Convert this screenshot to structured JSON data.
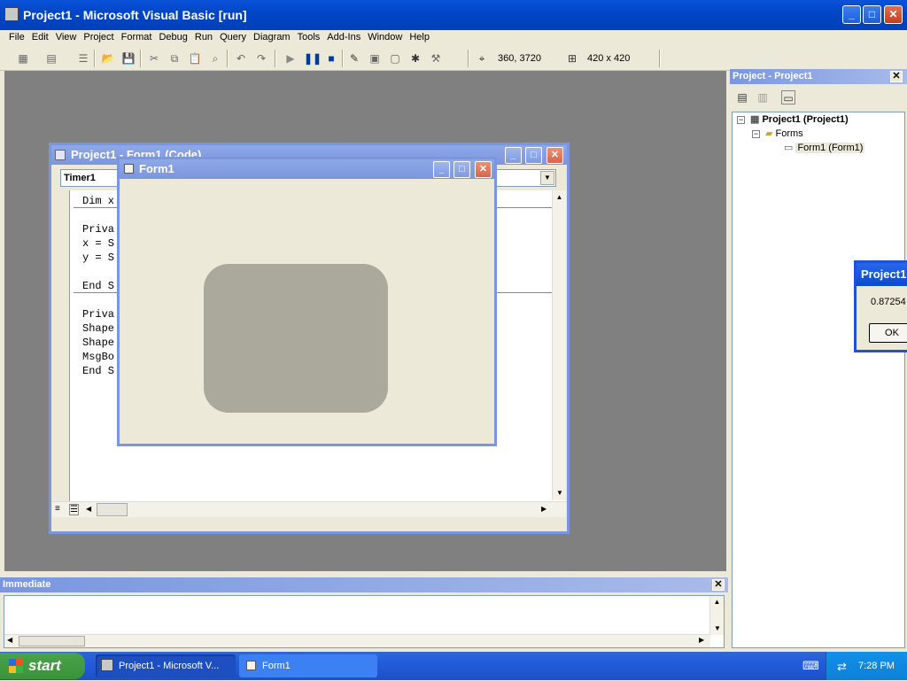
{
  "app": {
    "title": "Project1 - Microsoft Visual Basic [run]"
  },
  "menu": [
    "File",
    "Edit",
    "View",
    "Project",
    "Format",
    "Debug",
    "Run",
    "Query",
    "Diagram",
    "Tools",
    "Add-Ins",
    "Window",
    "Help"
  ],
  "toolbar": {
    "position": "360, 3720",
    "size": "420 x 420"
  },
  "project_panel": {
    "title": "Project - Project1",
    "tree": {
      "root": "Project1 (Project1)",
      "folder": "Forms",
      "item": "Form1 (Form1)"
    }
  },
  "code_window": {
    "title": "Project1 - Form1 (Code)",
    "object_combo": "Timer1",
    "lines": [
      "Dim x",
      "Priva",
      "x = S",
      "y = S",
      "End S",
      "Priva",
      "Shape",
      "Shape",
      "MsgBo",
      "End S"
    ]
  },
  "form_window": {
    "title": "Form1",
    "shape_color": "#aba99b"
  },
  "msgbox": {
    "title": "Project1",
    "message": "0.87254",
    "ok_label": "OK"
  },
  "immediate": {
    "title": "Immediate"
  },
  "taskbar": {
    "start_label": "start",
    "tasks": [
      "Project1 - Microsoft V...",
      "Form1"
    ],
    "clock": "7:28 PM"
  }
}
